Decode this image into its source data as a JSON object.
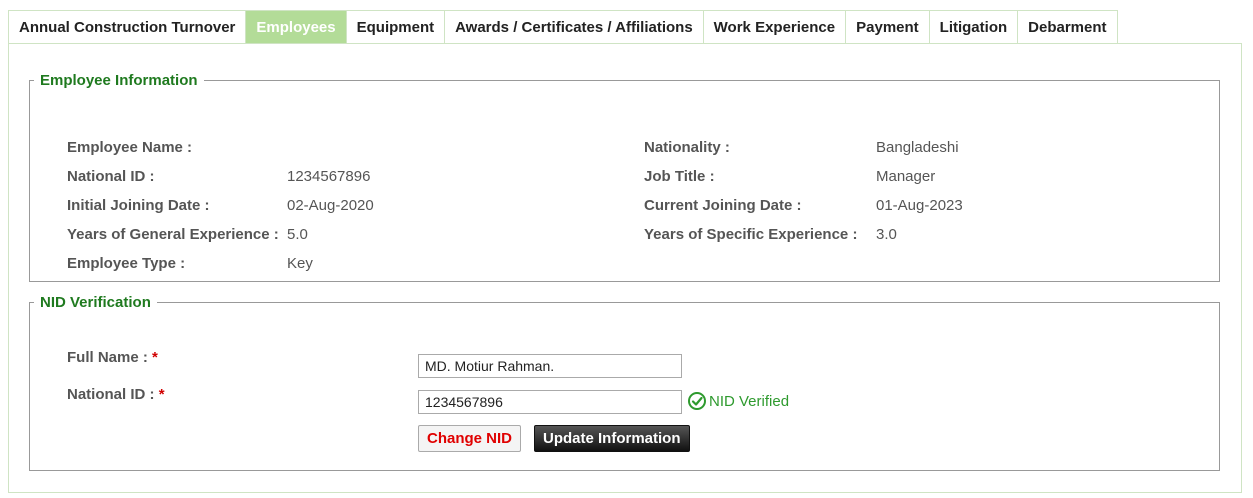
{
  "tabs": [
    {
      "label": "Annual Construction Turnover"
    },
    {
      "label": "Employees"
    },
    {
      "label": "Equipment"
    },
    {
      "label": "Awards / Certificates / Affiliations"
    },
    {
      "label": "Work Experience"
    },
    {
      "label": "Payment"
    },
    {
      "label": "Litigation"
    },
    {
      "label": "Debarment"
    }
  ],
  "employee_info": {
    "legend": "Employee Information",
    "name_label": "Employee Name :",
    "name_value": "",
    "nid_label": "National ID :",
    "nid_value": "1234567896",
    "initial_joining_label": "Initial Joining Date :",
    "initial_joining_value": "02-Aug-2020",
    "general_exp_label": "Years of General Experience :",
    "general_exp_value": "5.0",
    "type_label": "Employee Type :",
    "type_value": "Key",
    "nationality_label": "Nationality :",
    "nationality_value": "Bangladeshi",
    "job_title_label": "Job Title :",
    "job_title_value": "Manager",
    "current_joining_label": "Current Joining Date :",
    "current_joining_value": "01-Aug-2023",
    "specific_exp_label": "Years of Specific Experience :",
    "specific_exp_value": "3.0"
  },
  "nid_verification": {
    "legend": "NID Verification",
    "full_name_label": "Full Name :",
    "full_name_value": "MD. Motiur Rahman.",
    "national_id_label": "National ID :",
    "national_id_value": "1234567896",
    "required_mark": "*",
    "verified_text": "NID Verified",
    "change_nid_label": "Change NID",
    "update_label": "Update Information"
  },
  "colors": {
    "active_tab": "#b3dc98",
    "legend": "#1f7a1f",
    "verified": "#2e9a2e",
    "required": "#d00000"
  },
  "icons": {
    "verified": "check-circle-icon"
  }
}
